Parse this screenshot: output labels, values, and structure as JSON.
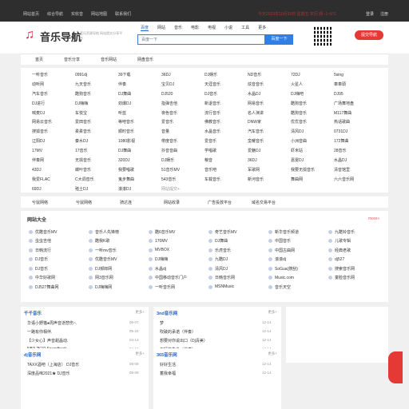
{
  "topbar": {
    "nav": [
      "网站首页",
      "综合导航",
      "实收音",
      "网站地图",
      "联系我们"
    ],
    "date": "今天2023年10月20日 星期五 农历 晴  -1~6℃",
    "links": [
      "登录",
      "注册"
    ]
  },
  "header": {
    "logo_text": "音乐导航",
    "slogan": "音乐资源导航 网站提交分享平台",
    "tabs": [
      "百度",
      "网站",
      "音乐",
      "电影",
      "电视",
      "小说",
      "工具",
      "更多"
    ],
    "search_placeholder": "百度一下",
    "search_button": "百度一下",
    "add_button": "提交导航"
  },
  "mainnav": [
    "首页",
    "音乐分享",
    "音乐网站",
    "网盘音乐"
  ],
  "links": [
    "一听音乐",
    "0991dj",
    "39下载",
    "36DJ",
    "DJ娱乐",
    "ND音乐",
    "72DJ",
    "5sing",
    "动听网",
    "九天音乐",
    "伴奏",
    "宝贝DJ",
    "天涯音乐",
    "炫音音乐",
    "火星人",
    "車車頭",
    "汽车音乐",
    "酷狗音乐",
    "DJ舞曲",
    "DJ520",
    "DJ音乐",
    "水晶DJ",
    "DJ嗨吧",
    "DJ95",
    "DJ进行",
    "DJ嗨嗨",
    "劲爆DJ",
    "指弹吉他",
    "新退音乐",
    "网易音乐",
    "酷狗音乐",
    "广场舞地盘",
    "喊麦DJ",
    "车悦宝",
    "听蓝",
    "夜色音乐",
    "流行音乐",
    "名人演讲",
    "酷狗音乐",
    "M117舞曲",
    "网易云音乐",
    "爱田音乐",
    "等吧音乐",
    "爱音乐",
    "佛教音乐",
    "DNW家",
    "优优音乐",
    "热话歌曲",
    "搜狐音乐",
    "柔柔音乐",
    "顺时音乐",
    "音量",
    "水晶音乐",
    "汽车音乐",
    "清风DJ",
    "0731DJ",
    "辽阳DJ",
    "秦水DJ",
    "1080影视",
    "帶度音乐",
    "爱音乐",
    "蛮耀音乐",
    "小洲音曲",
    "172舞曲",
    "17MV",
    "17音乐",
    "DJ舞曲",
    "抖音音曲",
    "学唱歌",
    "爱魅DJ",
    "虾米站",
    "28音乐",
    "伴奏网",
    "无损音乐",
    "320DJ",
    "DJ娱乐",
    "粮音",
    "36DJ",
    "嘉雯DJ",
    "水晶DJ",
    "43DJ",
    "蝶叶音乐",
    "我要唱歌",
    "51音乐MV",
    "音乐吧",
    "军歌网",
    "我要无损音乐",
    "清音馆里",
    "我爱FLAC",
    "C大调音乐",
    "鬼步舞曲",
    "543音乐",
    "车载音乐",
    "新河音乐",
    "舞曲网",
    "六六音乐网",
    "69DJ",
    "殖土DJ",
    "滚滚DJ",
    "网站提交+"
  ],
  "catbar": [
    "兮鼠网络",
    "兮鼠网络",
    "骑达连",
    "网站收录",
    "广告投放平台",
    "域名交易平台"
  ],
  "sites": {
    "title": "网站大全",
    "more": "more»",
    "items": [
      "优酷音乐MV",
      "音乐人先锋榜",
      "酷6音乐MV",
      "奇艺音乐MV",
      "新华音乐频道",
      "九酷铃音乐",
      "虫虫吉他",
      "酷我K歌",
      "170MV",
      "DJ舞曲",
      "中国音乐",
      "儿歌专辑",
      "日韩流行",
      "一听mv音乐",
      "MVBOX",
      "乐虎音乐",
      "中国古曲网",
      "经典老歌",
      "DJ音乐",
      "优酷音乐MV",
      "DJ嗨嗨",
      "九酷DJ",
      "滚滚dj",
      "dj527",
      "DJ音乐",
      "DJ郝郎网",
      "水晶dj",
      "清风DJ",
      "SoGua(搜刮)",
      "搜索音乐网",
      "中华好歌网",
      "网3音乐网",
      "中国移动音乐门户",
      "日韩音乐网",
      "Music.com",
      "童脸音乐网",
      "DJ527舞曲网",
      "DJ嗨嗨网",
      "一听音乐网",
      "MSNMusic",
      "音乐天空"
    ]
  },
  "panel1": {
    "title": "千千音乐",
    "more": "更多+",
    "rows": [
      {
        "t": "华语小野猫●周声音逝悲伤~.",
        "d": "06-07"
      },
      {
        "t": "一路有你相伴.",
        "d": "05-22"
      },
      {
        "t": "【少女心】声音甜晶动.",
        "d": "04-13"
      },
      {
        "t": "NBA 2K19 Soundtrack.",
        "d": "04-13"
      },
      {
        "t": "美乐人徒.",
        "d": "04-09"
      }
    ]
  },
  "panel2": {
    "title": "3nd音乐网",
    "more": "更多+",
    "rows": [
      {
        "t": "梦",
        "d": "12-14"
      },
      {
        "t": "吹破的承诺（伴奏）",
        "d": "12-14"
      },
      {
        "t": "想要对你说出口（Dj清美）",
        "d": "12-14"
      },
      {
        "t": "年轻的生命（伴奏）",
        "d": "12-14"
      },
      {
        "t": "梦（伴奏）",
        "d": "12-14"
      }
    ]
  },
  "panel3": {
    "title": "dj音乐网",
    "more": "更多+",
    "rows": [
      {
        "t": "TAXX酒吧（上海店） DJ音乐",
        "d": "08-09"
      },
      {
        "t": "深度品味2021★ DJ音乐",
        "d": "08-09"
      }
    ]
  },
  "panel4": {
    "title": "365音乐网",
    "more": "更多+",
    "rows": [
      {
        "t": "好好生活",
        "d": "12-14"
      },
      {
        "t": "蓄我幸福",
        "d": "12-14"
      }
    ]
  }
}
